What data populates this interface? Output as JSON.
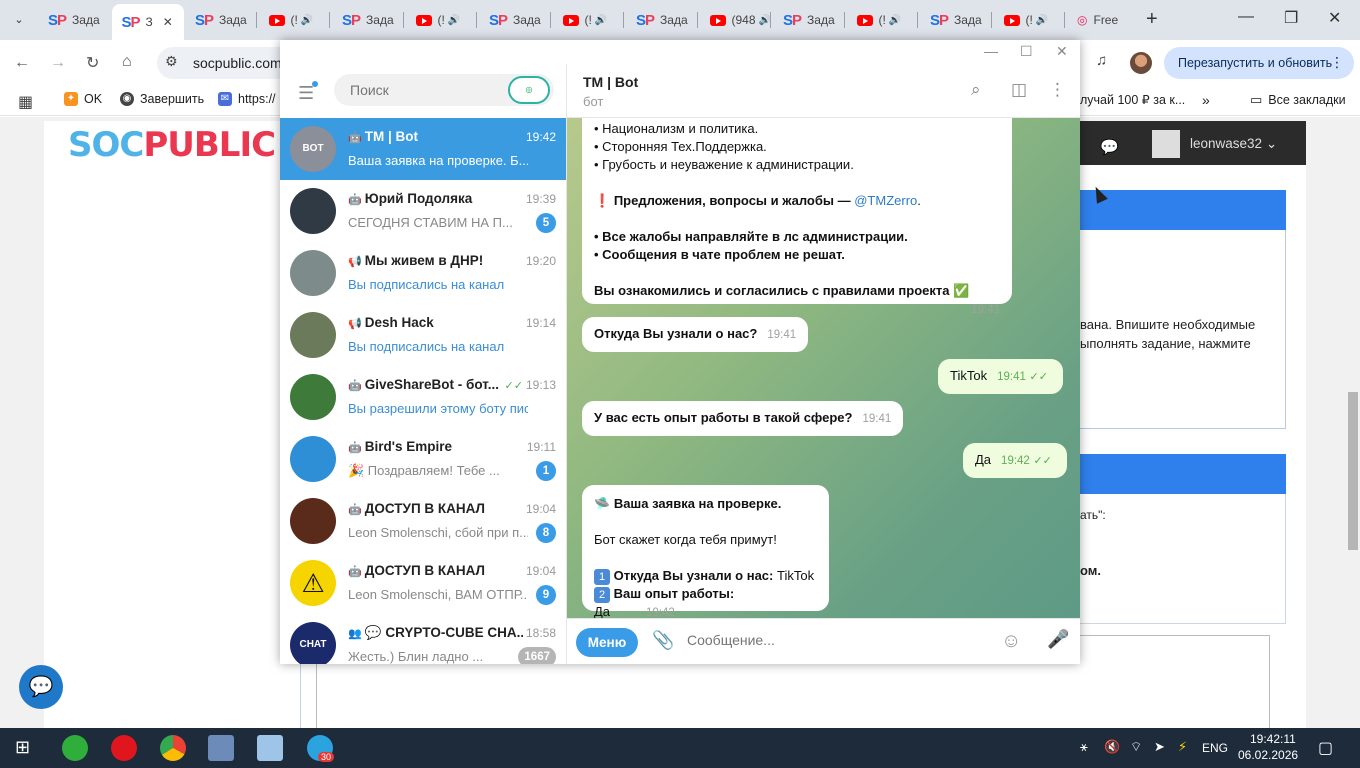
{
  "browser": {
    "tabs": [
      {
        "label": "Зада",
        "kind": "sp"
      },
      {
        "label": "З",
        "kind": "sp",
        "active": true
      },
      {
        "label": "Зада",
        "kind": "sp"
      },
      {
        "label": "(!",
        "kind": "yt"
      },
      {
        "label": "Зада",
        "kind": "sp"
      },
      {
        "label": "(!",
        "kind": "yt"
      },
      {
        "label": "Зада",
        "kind": "sp"
      },
      {
        "label": "(!",
        "kind": "yt"
      },
      {
        "label": "Зада",
        "kind": "sp"
      },
      {
        "label": "(948",
        "kind": "yt"
      },
      {
        "label": "Зада",
        "kind": "sp"
      },
      {
        "label": "(!",
        "kind": "yt"
      },
      {
        "label": "Зада",
        "kind": "sp"
      },
      {
        "label": "(!",
        "kind": "yt"
      },
      {
        "label": "Free",
        "kind": "other"
      }
    ],
    "url": "socpublic.com",
    "relaunch_label": "Перезапустить и обновить",
    "bookmarks": {
      "ok": "OK",
      "finish": "Завершить",
      "https": "https://",
      "promo": "лучай 100 ₽ за к...",
      "all": "Все закладки"
    }
  },
  "site": {
    "logo_soc": "SOC",
    "logo_pub": "PUBLIC",
    "username": "leonwase32",
    "text1": "вана. Впишите необходимые",
    "text2": "ыполнять задание, нажмите",
    "text3": "ать\":",
    "text4": "ом."
  },
  "telegram": {
    "search_placeholder": "Поиск",
    "chats": [
      {
        "name": "TM | Bot",
        "time": "19:42",
        "preview": "Ваша заявка на проверке. Б...",
        "badge": "",
        "active": true,
        "color": "#8a8f9a",
        "av": "BOT"
      },
      {
        "name": "Юрий Подоляка",
        "time": "19:39",
        "preview": "СЕГОДНЯ СТАВИМ НА П...",
        "badge": "5",
        "color": "#2f3a44",
        "av": ""
      },
      {
        "name": "Мы живем в ДНР!",
        "time": "19:20",
        "preview": "Вы подписались на канал",
        "badge": "",
        "blue": true,
        "color": "#7d8c8a",
        "av": ""
      },
      {
        "name": "Desh Hack",
        "time": "19:14",
        "preview": "Вы подписались на канал",
        "badge": "",
        "blue": true,
        "color": "#6b7a5a",
        "av": ""
      },
      {
        "name": "GiveShareBot - бот...",
        "time": "19:13",
        "preview": "Вы разрешили этому боту писа...",
        "badge": "",
        "blue": true,
        "ticks": true,
        "color": "#3e7a3a",
        "av": ""
      },
      {
        "name": "Bird's Empire",
        "time": "19:11",
        "preview": "🎉 Поздравляем!  Тебе ...",
        "badge": "1",
        "color": "#2f8fd6",
        "av": ""
      },
      {
        "name": "ДОСТУП В КАНАЛ",
        "time": "19:04",
        "preview": "Leon Smolenschi, сбой при п...",
        "badge": "8",
        "color": "#5a2a1a",
        "av": ""
      },
      {
        "name": "ДОСТУП В КАНАЛ",
        "time": "19:04",
        "preview": "Leon Smolenschi, ВАМ ОТПР...",
        "badge": "9",
        "color": "#f5d400",
        "av": "⚠"
      },
      {
        "name": "💬 CRYPTO-CUBE CHA...",
        "time": "18:58",
        "preview": "Жесть.) Блин ладно ...",
        "badge": "1667",
        "muted": true,
        "color": "#1a2a6a",
        "av": "CHAT"
      }
    ],
    "header_name": "TM | Bot",
    "header_sub": "бот",
    "messages": {
      "rules_line1": "• Национализм и политика.",
      "rules_line2": "• Сторонняя Тех.Поддержка.",
      "rules_line3": "• Грубость и неуважение к администрации.",
      "suggest_prefix": "Предложения, вопросы и жалобы — ",
      "suggest_link": "@TMZerro",
      "complaints1": "• Все жалобы направляйте в лс администрации.",
      "complaints2": "• Сообщения в чате проблем не решат.",
      "agreed": "Вы ознакомились и согласились с правилами проекта ✅",
      "agreed_time": "19:41",
      "q1": "Откуда Вы узнали о нас?",
      "q1_time": "19:41",
      "a1": "TikTok",
      "a1_time": "19:41",
      "q2": "У вас есть опыт работы в такой сфере?",
      "q2_time": "19:41",
      "a2": "Да",
      "a2_time": "19:42",
      "review_title": "Ваша заявка на проверке.",
      "review_line": "Бот скажет когда тебя примут!",
      "review_q1_label": "Откуда Вы узнали о нас:",
      "review_q1_val": "TikTok",
      "review_q2_label": "Ваш опыт работы:",
      "review_q2_val": "Да",
      "review_time": "19:42"
    },
    "menu_label": "Меню",
    "input_placeholder": "Сообщение..."
  },
  "taskbar": {
    "lang": "ENG",
    "time": "19:42:11",
    "date": "06.02.2026",
    "tg_badge": "30"
  }
}
